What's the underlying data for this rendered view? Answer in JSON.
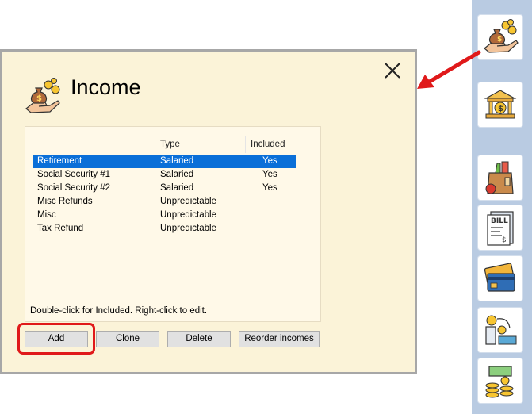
{
  "dialog": {
    "title": "Income",
    "close_icon": "close-icon",
    "title_icon": "money-bag-hand-icon"
  },
  "income_list": {
    "columns": [
      "",
      "Type",
      "Included"
    ],
    "rows": [
      {
        "name": "Retirement",
        "type": "Salaried",
        "included": "Yes",
        "selected": true
      },
      {
        "name": "Social Security #1",
        "type": "Salaried",
        "included": "Yes",
        "selected": false
      },
      {
        "name": "Social Security #2",
        "type": "Salaried",
        "included": "Yes",
        "selected": false
      },
      {
        "name": "Misc Refunds",
        "type": "Unpredictable",
        "included": "",
        "selected": false
      },
      {
        "name": "Misc",
        "type": "Unpredictable",
        "included": "",
        "selected": false
      },
      {
        "name": "Tax Refund",
        "type": "Unpredictable",
        "included": "",
        "selected": false
      }
    ],
    "hint": "Double-click for Included. Right-click to edit."
  },
  "buttons": {
    "add": "Add",
    "clone": "Clone",
    "delete": "Delete",
    "reorder": "Reorder incomes"
  },
  "sidebar": {
    "items": [
      {
        "icon": "income-money-bag-icon"
      },
      {
        "icon": "bank-icon"
      },
      {
        "icon": "groceries-bag-icon"
      },
      {
        "icon": "bill-icon"
      },
      {
        "icon": "credit-card-icon"
      },
      {
        "icon": "transfer-money-icon"
      },
      {
        "icon": "cash-coins-icon"
      }
    ]
  },
  "colors": {
    "dialog_bg": "#fbf3d8",
    "selection": "#0a6fd8",
    "highlight": "#e0191a",
    "sidebar_bg": "#b9cbe2"
  }
}
